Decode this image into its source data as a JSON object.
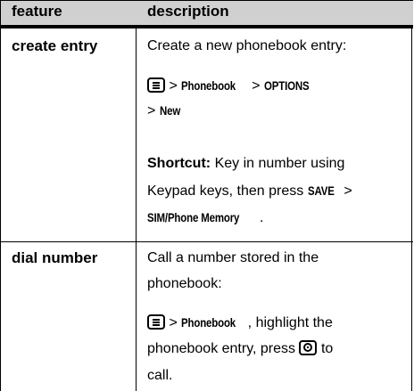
{
  "table": {
    "header": {
      "feature": "feature",
      "description": "description"
    },
    "rows": [
      {
        "feature": "create entry",
        "intro": "Create a new phonebook entry:",
        "path_gt1": ">",
        "path_phonebook": "Phonebook",
        "path_gt2": ">",
        "path_options": "OPTIONS",
        "path_gt3": ">",
        "path_new": "New",
        "shortcut_label": "Shortcut:",
        "shortcut_text1": "Key in number using",
        "shortcut_text2": "Keypad keys, then press",
        "shortcut_save": "SAVE",
        "shortcut_gt": ">",
        "shortcut_memory": "SIM/Phone Memory",
        "shortcut_period": "."
      },
      {
        "feature": "dial number",
        "intro_line1": "Call a number stored in the",
        "intro_line2": "phonebook:",
        "path_gt": ">",
        "path_phonebook": "Phonebook",
        "path_rest": ", highlight the",
        "line2_a": "phonebook entry, press",
        "line2_b": "to",
        "line3": "call."
      }
    ]
  },
  "icons": {
    "menu": "menu-key-icon",
    "nav": "navigation-key-icon"
  }
}
